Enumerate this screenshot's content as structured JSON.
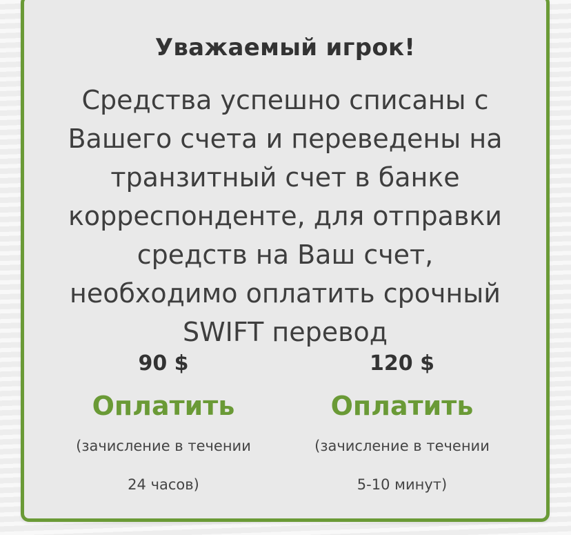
{
  "card": {
    "title": "Уважаемый игрок!",
    "message": "Средства успешно списаны с Вашего счета и переведены на транзитный счет в банке корреспонденте, для отправки средств на Ваш счет, необходимо оплатить срочный SWIFT перевод",
    "accent_color": "#6a9a36"
  },
  "options": [
    {
      "price": "90 $",
      "pay_label": "Оплатить",
      "note_line1": "(зачисление в течении",
      "note_line2": "24 часов)"
    },
    {
      "price": "120 $",
      "pay_label": "Оплатить",
      "note_line1": "(зачисление в течении",
      "note_line2": "5-10 минут)"
    }
  ]
}
